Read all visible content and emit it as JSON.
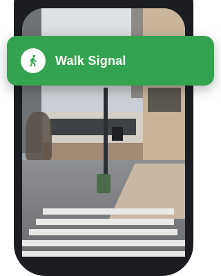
{
  "notification": {
    "title": "Walk Signal",
    "icon": "pedestrian-walk-icon",
    "color": "#34a34f"
  }
}
